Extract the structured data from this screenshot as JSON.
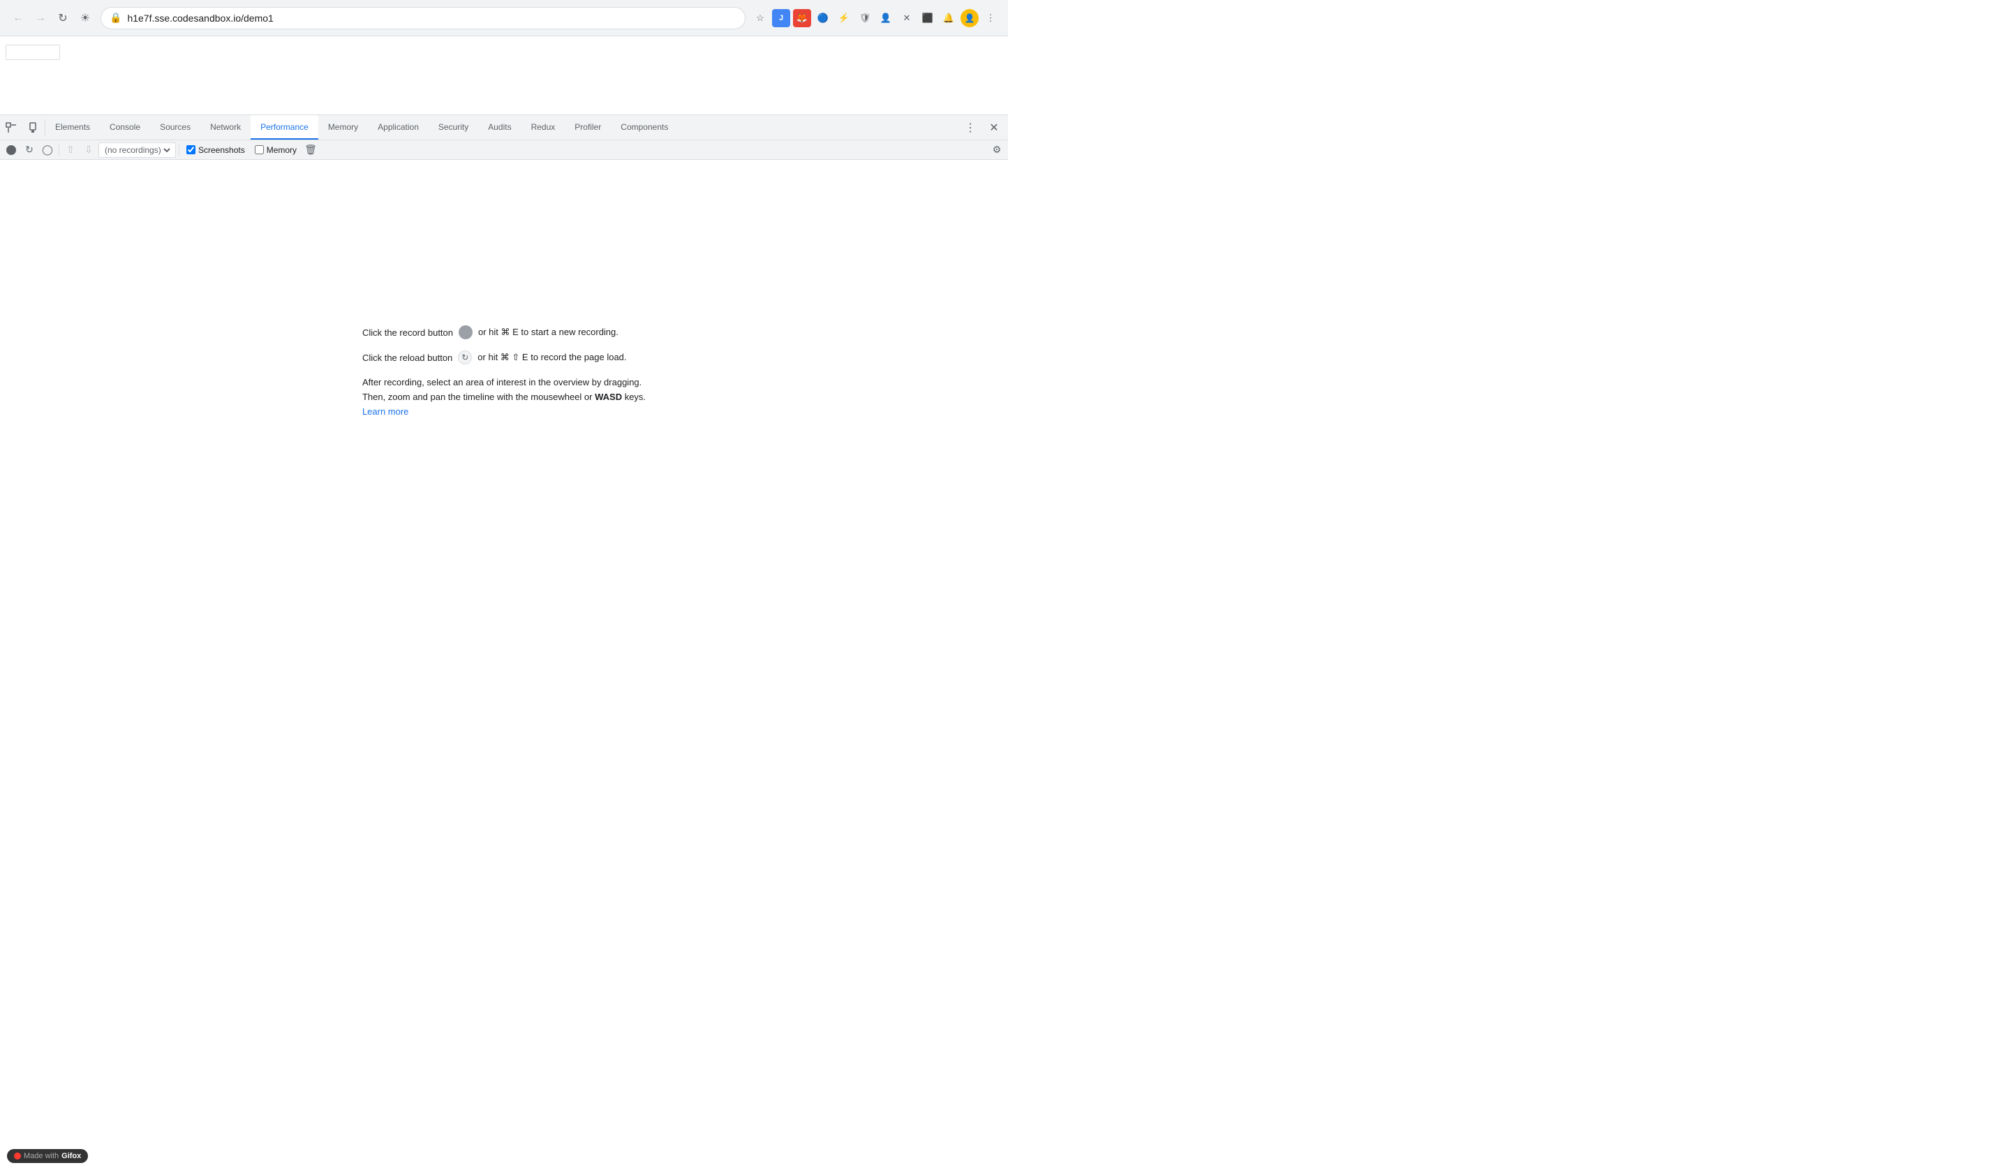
{
  "browser": {
    "url": "h1e7f.sse.codesandbox.io/demo1",
    "back_btn": "←",
    "forward_btn": "→",
    "refresh_btn": "↻",
    "home_btn": "⌂"
  },
  "devtools": {
    "tabs": [
      {
        "id": "elements",
        "label": "Elements",
        "active": false
      },
      {
        "id": "console",
        "label": "Console",
        "active": false
      },
      {
        "id": "sources",
        "label": "Sources",
        "active": false
      },
      {
        "id": "network",
        "label": "Network",
        "active": false
      },
      {
        "id": "performance",
        "label": "Performance",
        "active": true
      },
      {
        "id": "memory",
        "label": "Memory",
        "active": false
      },
      {
        "id": "application",
        "label": "Application",
        "active": false
      },
      {
        "id": "security",
        "label": "Security",
        "active": false
      },
      {
        "id": "audits",
        "label": "Audits",
        "active": false
      },
      {
        "id": "redux",
        "label": "Redux",
        "active": false
      },
      {
        "id": "profiler",
        "label": "Profiler",
        "active": false
      },
      {
        "id": "components",
        "label": "Components",
        "active": false
      }
    ],
    "toolbar": {
      "screenshots_label": "Screenshots",
      "memory_label": "Memory",
      "recordings_placeholder": "(no recordings)"
    }
  },
  "performance_panel": {
    "line1_before": "Click the record button",
    "line1_after": "or hit ⌘ E to start a new recording.",
    "line2_before": "Click the reload button",
    "line2_after": "or hit ⌘ ⇧ E to record the page load.",
    "line3": "After recording, select an area of interest in the overview by dragging.",
    "line4_before": "Then, zoom and pan the timeline with the mousewheel or ",
    "line4_bold": "WASD",
    "line4_after": " keys.",
    "learn_more": "Learn more"
  },
  "gifox": {
    "made_with": "Made with",
    "brand": "Gifox"
  }
}
